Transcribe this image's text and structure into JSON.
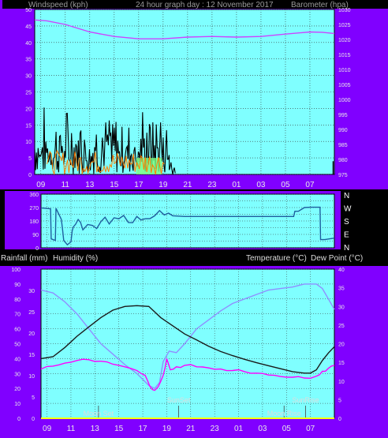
{
  "header": {
    "left": "Windspeed (kph)",
    "center": "24 hour graph day : 12 November 2017",
    "right": "Barometer (hpa)"
  },
  "colors": {
    "plot_bg": "#7fffff",
    "purple_bg": "#8000ff",
    "windspeed": "#000000",
    "gust": "#2a2a2a",
    "avg_wind": "#ff8000",
    "barometer": "#cc44ff",
    "direction": "#1f5f9f",
    "temperature": "#1a1a1a",
    "humidity": "#8f8fff",
    "dewpoint": "#ff00ff",
    "rainfall": "#ffff00"
  },
  "legend_bottom": {
    "rainfall": "Rainfall (mm)",
    "humidity": "Humidity (%)",
    "temperature": "Temperature (°C)",
    "dewpoint": "Dew Point (°C)"
  },
  "chart_data": [
    {
      "type": "line",
      "name": "wind-barometer",
      "x_tick_labels": [
        "11",
        "13",
        "15",
        "17",
        "19",
        "21",
        "23",
        "01",
        "03",
        "05",
        "07",
        "09"
      ],
      "left_axis": {
        "label": "Windspeed (kph)",
        "range": [
          0,
          50
        ],
        "ticks": [
          0,
          5,
          10,
          15,
          20,
          25,
          30,
          35,
          40,
          45,
          50
        ]
      },
      "right_axis": {
        "label": "Barometer (hpa)",
        "range": [
          975,
          1030
        ],
        "ticks": [
          975,
          980,
          985,
          990,
          995,
          1000,
          1005,
          1010,
          1015,
          1020,
          1025,
          1030
        ]
      },
      "series": [
        {
          "name": "Windspeed (kph)",
          "role": "windspeed",
          "pattern": "spiky",
          "segments": [
            {
              "x": [
                8.5,
                19.5
              ],
              "max": 22
            },
            {
              "x": [
                19.5,
                20.0
              ],
              "max": 8
            }
          ],
          "late_spike": {
            "x": 8.9,
            "value": 4
          }
        },
        {
          "name": "Avg wind",
          "role": "avg",
          "pattern": "low",
          "segments": [
            {
              "x": [
                9.5,
                19.2
              ],
              "max": 8
            }
          ]
        },
        {
          "name": "Barometer (hpa)",
          "role": "barometer",
          "x": [
            8.5,
            9.5,
            11,
            13,
            15,
            17,
            19,
            21,
            23,
            25,
            27,
            29,
            31,
            32,
            33
          ],
          "values": [
            1026.5,
            1026.2,
            1025,
            1022.5,
            1021,
            1020.2,
            1020.2,
            1020.8,
            1021,
            1020.8,
            1021,
            1021.8,
            1022.5,
            1022.4,
            1022
          ]
        }
      ]
    },
    {
      "type": "line",
      "name": "wind-direction",
      "direction_labels": [
        "N",
        "W",
        "S",
        "E",
        "N"
      ],
      "left_axis": {
        "range": [
          0,
          360
        ],
        "ticks": [
          0,
          45,
          90,
          135,
          180,
          225,
          270,
          315,
          360
        ]
      },
      "series": [
        {
          "name": "Wind direction",
          "role": "direction",
          "x": [
            8.5,
            9.3,
            9.35,
            9.7,
            9.75,
            10.2,
            10.4,
            11.0,
            11.2,
            11.6,
            12.0,
            12.8,
            13.5,
            14.2,
            15.0,
            15.8,
            16.5,
            17.2,
            18.0,
            18.8,
            19.5,
            20.5,
            21.5,
            23.0,
            25.0,
            27.0,
            29.0,
            29.6,
            29.7,
            30.0,
            30.5,
            31.0,
            31.8,
            31.85,
            32.2,
            33.0
          ],
          "values": [
            268,
            262,
            60,
            50,
            265,
            190,
            50,
            40,
            140,
            190,
            120,
            150,
            175,
            160,
            195,
            170,
            210,
            195,
            215,
            220,
            215,
            210,
            210,
            210,
            210,
            210,
            210,
            210,
            245,
            245,
            270,
            272,
            272,
            55,
            55,
            65
          ]
        }
      ]
    },
    {
      "type": "line",
      "name": "temp-humidity",
      "x_tick_labels": [
        "11",
        "13",
        "15",
        "17",
        "19",
        "21",
        "23",
        "01",
        "03",
        "05",
        "07",
        "09"
      ],
      "left_axis": {
        "label": "Humidity (%)",
        "range": [
          0,
          100
        ],
        "ticks": [
          0,
          10,
          20,
          30,
          40,
          50,
          60,
          70,
          80,
          90,
          100
        ]
      },
      "left_axis_2": {
        "label": "Rainfall (mm)",
        "tick_labels": [
          "0",
          "5",
          "10",
          "15",
          "20",
          "25",
          "30"
        ]
      },
      "right_axis": {
        "label": "Temperature (°C)",
        "range": [
          0,
          40
        ],
        "ticks": [
          0,
          5,
          10,
          15,
          20,
          25,
          30,
          35,
          40
        ]
      },
      "annotations": [
        {
          "text": "Moon Set",
          "x": 13.3
        },
        {
          "text": "SunSet",
          "x": 20.0
        },
        {
          "text": "Moon Rise",
          "x": 28.8
        },
        {
          "text": "SunRise",
          "x": 30.6
        }
      ],
      "series": [
        {
          "name": "Temperature (°C)",
          "role": "temperature",
          "x": [
            8.5,
            9.5,
            10.5,
            11.5,
            12.5,
            13.5,
            14.5,
            15.5,
            16.5,
            17.5,
            18.0,
            18.5,
            19.5,
            20.5,
            21.5,
            22.5,
            23.5,
            24.5,
            25.5,
            26.5,
            27.5,
            28.5,
            29.5,
            30.5,
            31.0,
            31.5,
            32.0,
            32.5,
            33.0
          ],
          "values": [
            16,
            16.5,
            19,
            22,
            24.5,
            27,
            29,
            30,
            30.2,
            30,
            28.5,
            27,
            24.8,
            22.6,
            21,
            19.3,
            17.9,
            16.8,
            15.8,
            14.9,
            14.1,
            13.3,
            12.5,
            12.1,
            12.1,
            13,
            15.5,
            17.5,
            19.2
          ]
        },
        {
          "name": "Humidity (%)",
          "role": "humidity",
          "x": [
            8.5,
            9.5,
            10.5,
            11.5,
            12.5,
            13.5,
            14.5,
            15.5,
            16.5,
            17.5,
            18.0,
            18.4,
            18.7,
            19.2,
            19.8,
            20.5,
            21.5,
            22.5,
            23.5,
            24.5,
            25.5,
            26.5,
            27.5,
            28.5,
            29.5,
            30.5,
            31.5,
            32.0,
            32.5,
            33.0
          ],
          "values": [
            86,
            84,
            78,
            70,
            60,
            50,
            43,
            36,
            30,
            22,
            20,
            24,
            38,
            45,
            44,
            50,
            60,
            66,
            72,
            77,
            80,
            83,
            86,
            87,
            88,
            90,
            90,
            87,
            80,
            73
          ]
        },
        {
          "name": "Dew Point (°C)",
          "role": "dewpoint",
          "x": [
            8.5,
            9.5,
            10.5,
            11.5,
            12.5,
            13.5,
            14.5,
            15.5,
            16.5,
            17.2,
            17.6,
            18.0,
            18.3,
            18.7,
            19.0,
            19.3,
            19.8,
            20.5,
            21.5,
            22.5,
            23.5,
            24.5,
            25.5,
            26.5,
            27.5,
            28.5,
            29.5,
            30.5,
            31.5,
            32.0,
            32.5,
            33.0
          ],
          "values": [
            13.2,
            14.0,
            14.8,
            15.5,
            15.7,
            15.3,
            14.5,
            13.8,
            12.8,
            11.5,
            8.5,
            7.5,
            8.5,
            11.5,
            16.0,
            13.0,
            13.8,
            14.2,
            13.8,
            13.5,
            13.2,
            12.8,
            12.5,
            12.1,
            11.6,
            11.2,
            11.0,
            10.8,
            11.3,
            12.6,
            13.4,
            14.2
          ]
        },
        {
          "name": "Rainfall (mm)",
          "role": "rainfall",
          "x": [
            8.5,
            33.0
          ],
          "values": [
            0,
            0
          ]
        }
      ]
    }
  ]
}
